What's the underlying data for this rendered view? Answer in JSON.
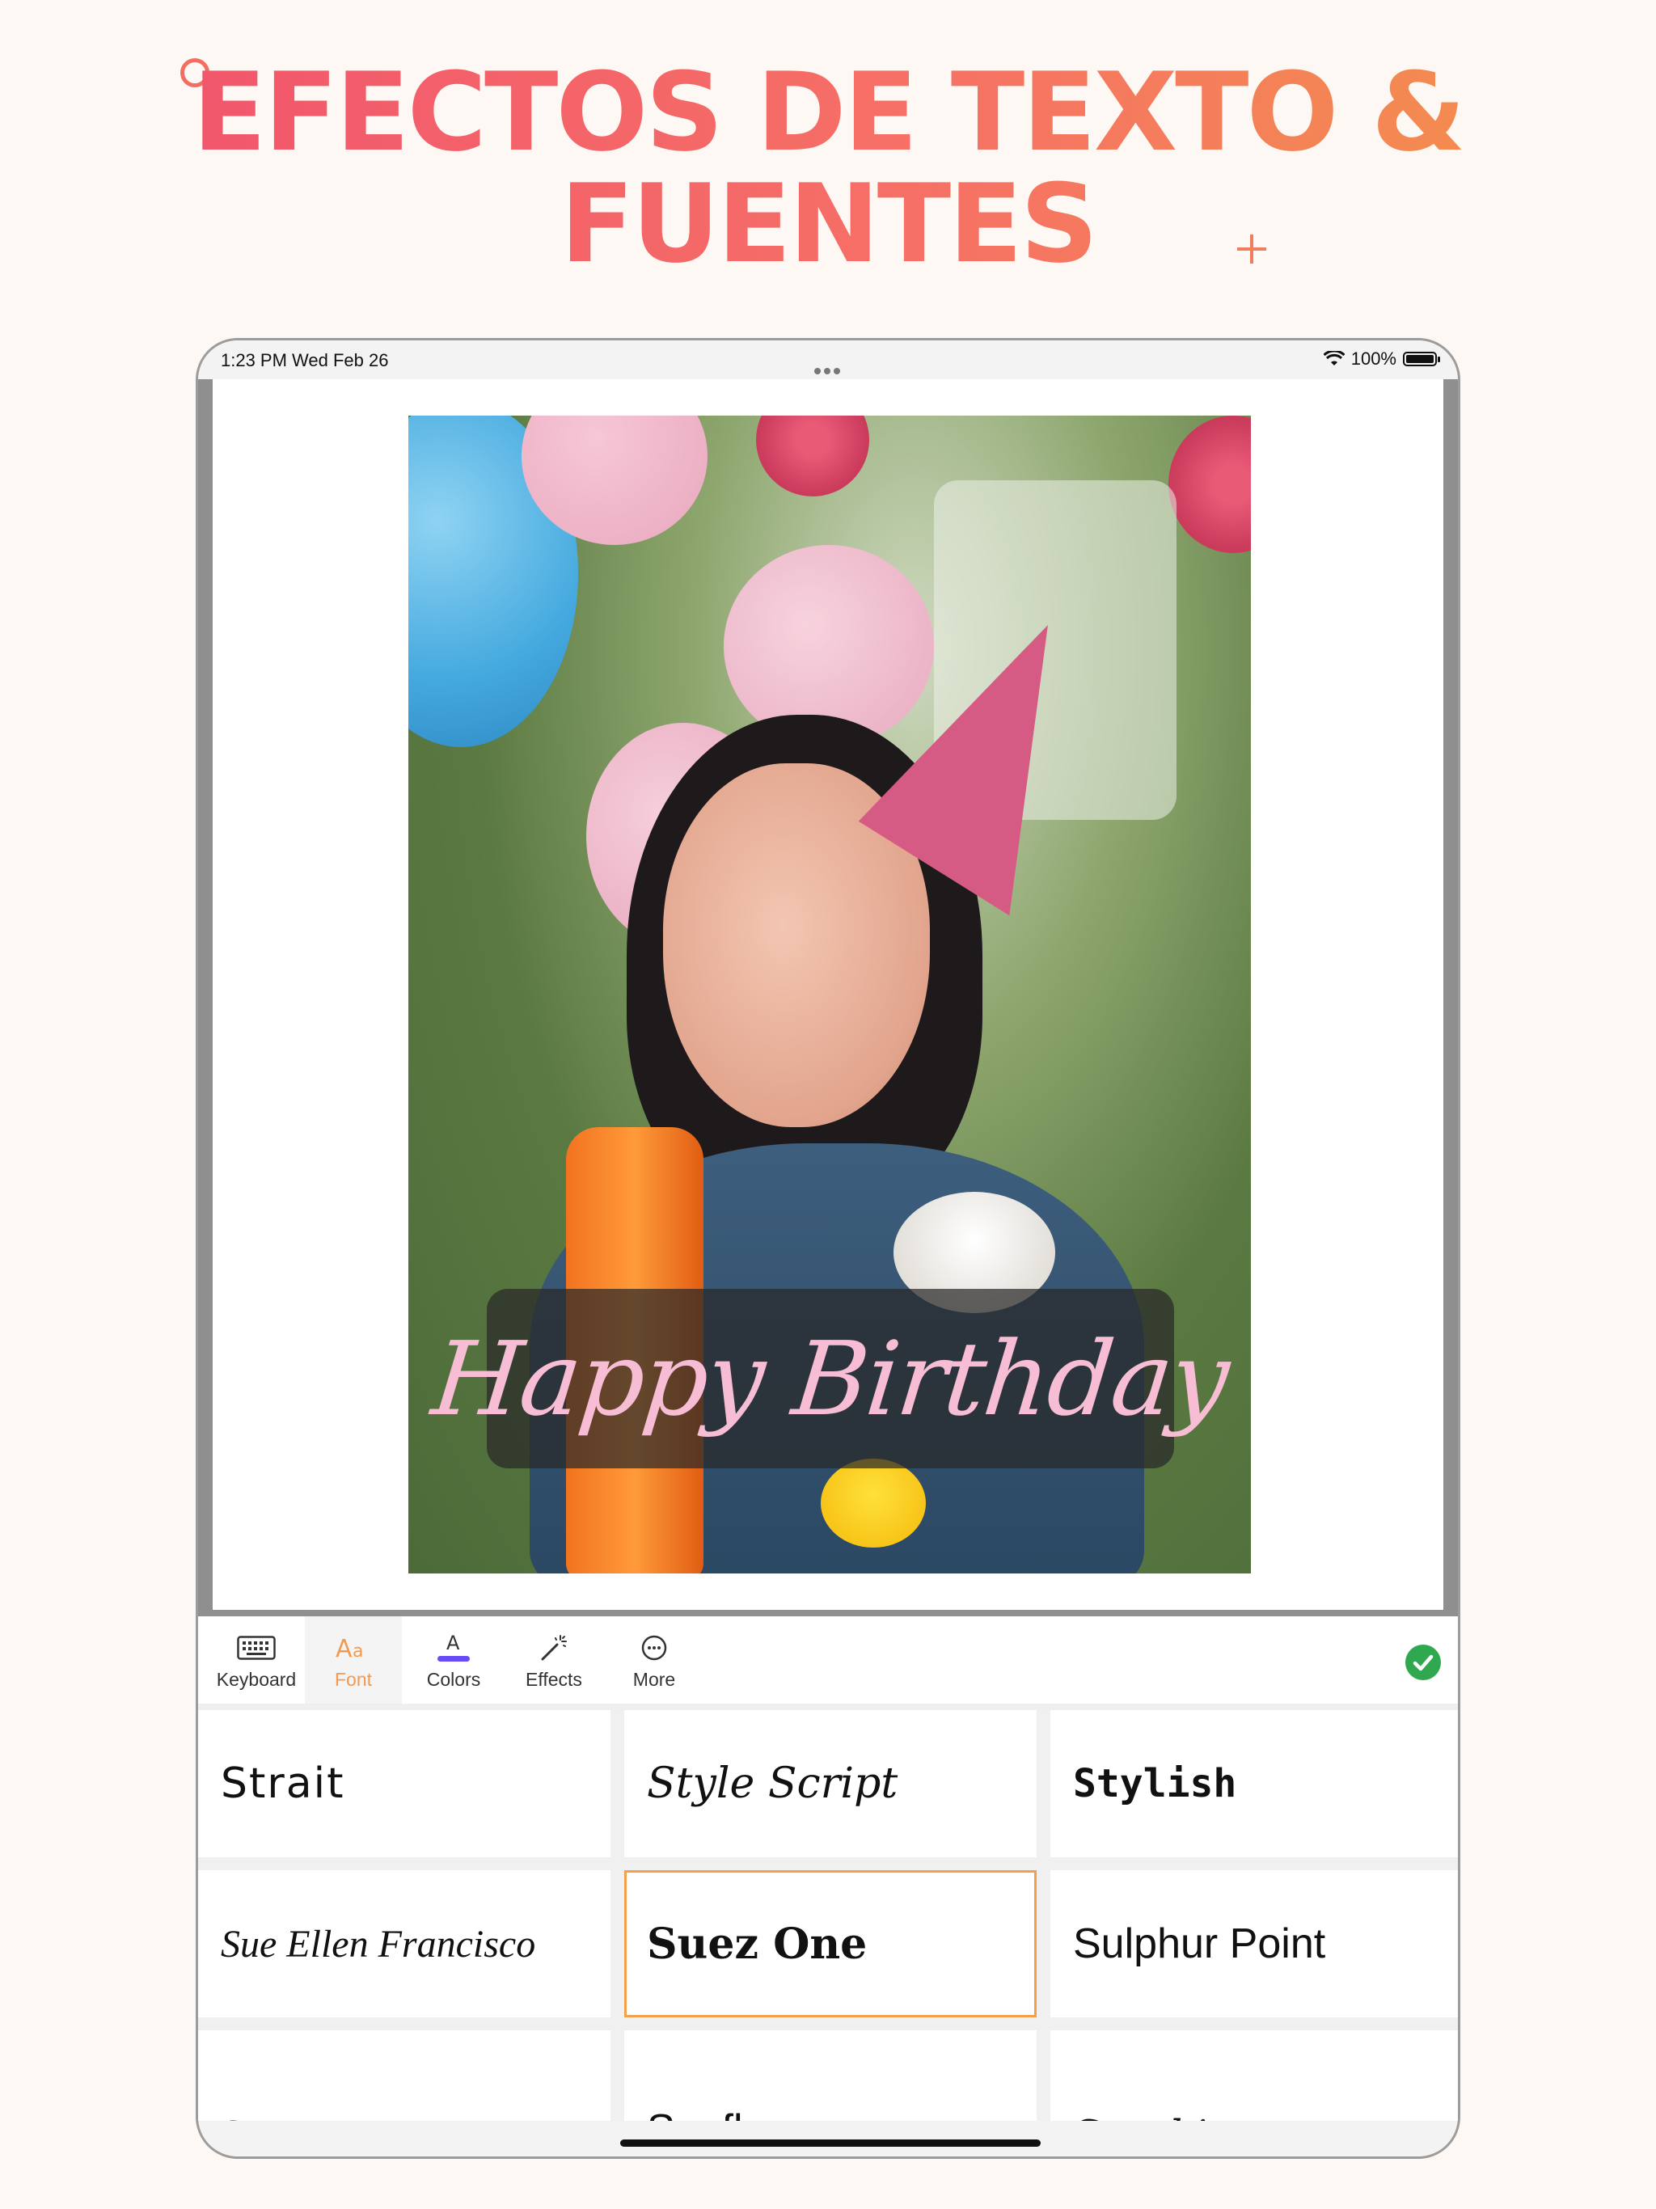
{
  "headline": {
    "line1": "EFECTOS DE TEXTO &",
    "line2": "FUENTES"
  },
  "status_bar": {
    "time": "1:23 PM   Wed Feb 26",
    "battery": "100%"
  },
  "photo": {
    "caption": "Happy Birthday",
    "caption_color": "#f6bdd4"
  },
  "toolbar": {
    "tools": [
      {
        "label": "Keyboard",
        "icon": "keyboard-icon"
      },
      {
        "label": "Font",
        "icon": "font-aa-icon",
        "active": true
      },
      {
        "label": "Colors",
        "icon": "text-color-icon"
      },
      {
        "label": "Effects",
        "icon": "magic-wand-icon"
      },
      {
        "label": "More",
        "icon": "more-circle-icon"
      }
    ],
    "confirm_icon": "checkmark-circle-icon",
    "accent": "#f39a52",
    "confirm_color": "#2fa84f"
  },
  "fonts": [
    {
      "name": "Strait"
    },
    {
      "name": "Style Script"
    },
    {
      "name": "Stylish"
    },
    {
      "name": "Sue Ellen Francisco"
    },
    {
      "name": "Suez One",
      "selected": true
    },
    {
      "name": "Sulphur Point"
    },
    {
      "name": "Sumana"
    },
    {
      "name": "Sunflower"
    },
    {
      "name": "Sunshiney"
    }
  ],
  "colors": {
    "background": "#fdf8f4",
    "selected_border": "#f3a04d"
  }
}
